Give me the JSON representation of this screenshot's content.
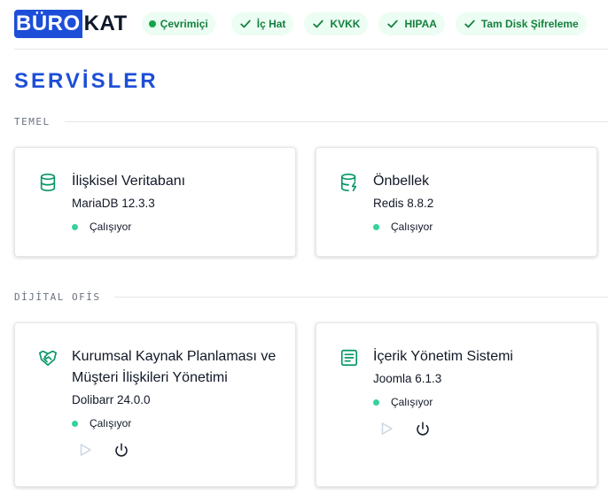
{
  "header": {
    "logo_part1": "BÜRO",
    "logo_part2": "KAT",
    "status": "Çevrimiçi",
    "badges": [
      "İç Hat",
      "KVKK",
      "HIPAA",
      "Tam Disk Şifreleme"
    ]
  },
  "page_title": "SERVİSLER",
  "sections": [
    {
      "label": "TEMEL",
      "cards": [
        {
          "title": "İlişkisel Veritabanı",
          "subtitle": "MariaDB 12.3.3",
          "status": "Çalışıyor",
          "icon": "database-icon"
        },
        {
          "title": "Önbellek",
          "subtitle": "Redis 8.8.2",
          "status": "Çalışıyor",
          "icon": "database-bolt-icon"
        }
      ]
    },
    {
      "label": "DİJİTAL OFİS",
      "cards": [
        {
          "title": "Kurumsal Kaynak Planlaması ve Müşteri İlişkileri Yönetimi",
          "subtitle": "Dolibarr 24.0.0",
          "status": "Çalışıyor",
          "icon": "handshake-icon"
        },
        {
          "title": "İçerik Yönetim Sistemi",
          "subtitle": "Joomla 6.1.3",
          "status": "Çalışıyor",
          "icon": "document-icon"
        }
      ]
    }
  ],
  "colors": {
    "brand": "#1d4ed8",
    "badge_bg": "#ecfdf3",
    "badge_text": "#15803d",
    "status_dot": "#34d399",
    "icon_green": "#059669"
  }
}
